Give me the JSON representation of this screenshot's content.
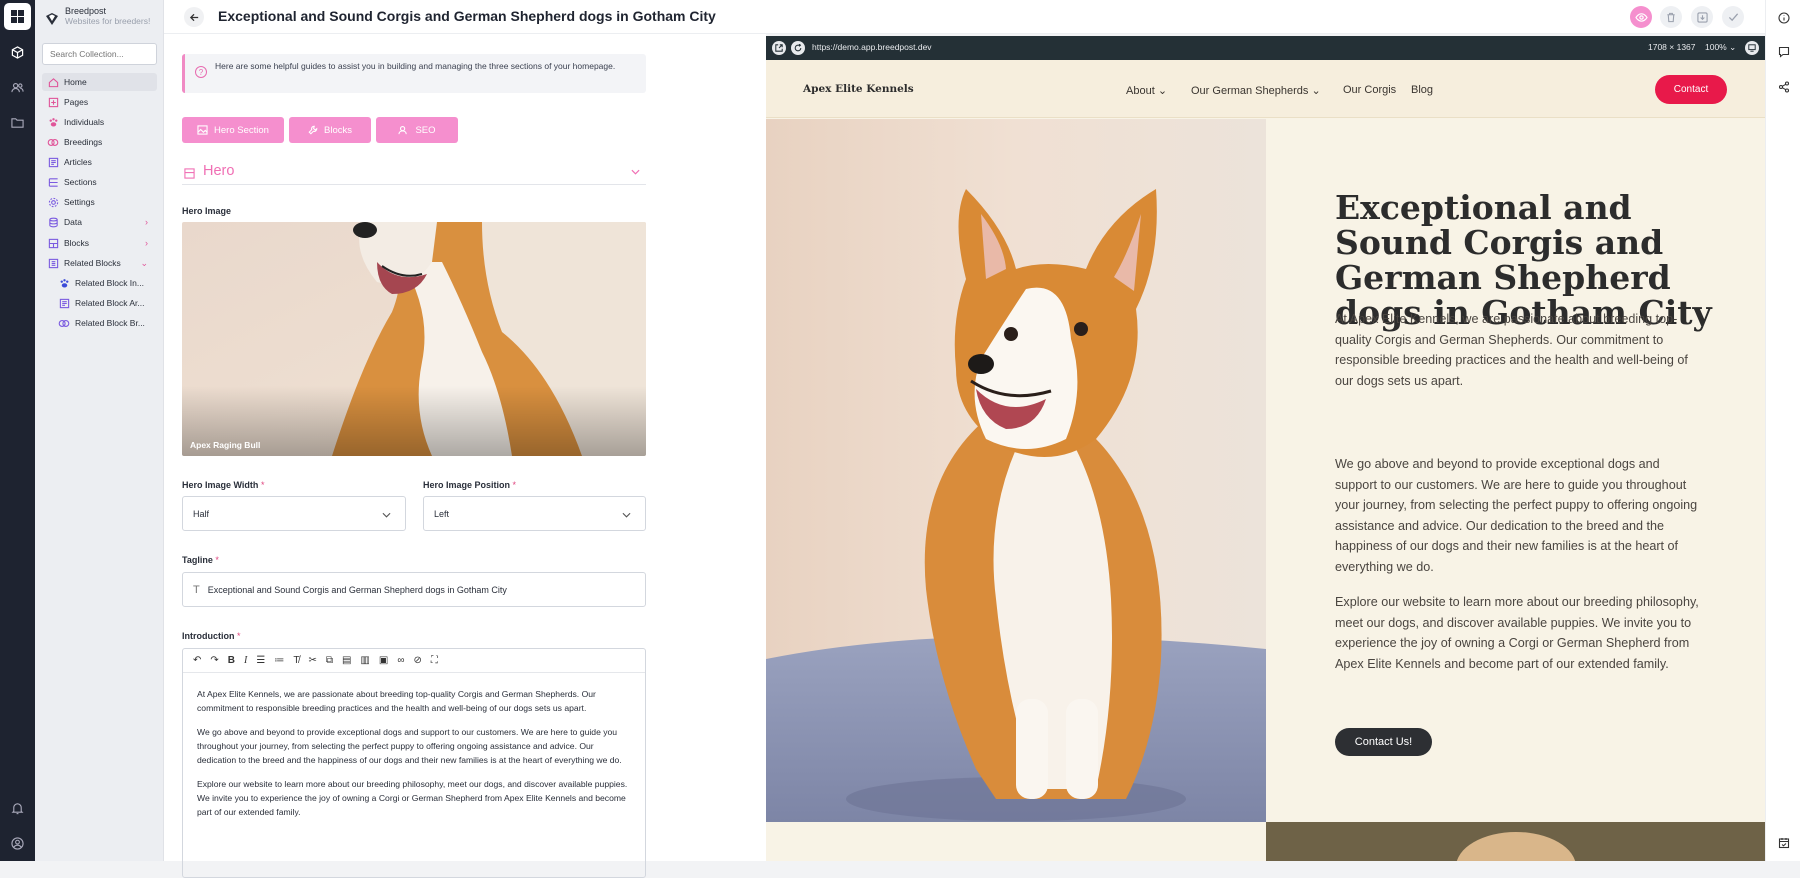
{
  "app": {
    "brand_name": "Breedpost",
    "brand_tagline": "Websites for breeders!",
    "search_placeholder": "Search Collection..."
  },
  "sidebar": {
    "items": [
      {
        "label": "Home",
        "icon": "home-icon",
        "active": true
      },
      {
        "label": "Pages",
        "icon": "plus-square-icon"
      },
      {
        "label": "Individuals",
        "icon": "paw-icon"
      },
      {
        "label": "Breedings",
        "icon": "rings-icon"
      },
      {
        "label": "Articles",
        "icon": "article-icon"
      },
      {
        "label": "Sections",
        "icon": "sections-icon"
      },
      {
        "label": "Settings",
        "icon": "gear-icon"
      },
      {
        "label": "Data",
        "icon": "database-icon",
        "chevron": "›"
      },
      {
        "label": "Blocks",
        "icon": "blocks-icon",
        "chevron": "›"
      },
      {
        "label": "Related Blocks",
        "icon": "related-blocks-icon",
        "chevron": "⌄"
      }
    ],
    "sub_items": [
      {
        "label": "Related Block In...",
        "icon": "paw-icon"
      },
      {
        "label": "Related Block Ar...",
        "icon": "article-icon"
      },
      {
        "label": "Related Block Br...",
        "icon": "rings-icon"
      }
    ]
  },
  "header": {
    "title": "Exceptional and Sound Corgis and German Shepherd dogs in Gotham City"
  },
  "editor": {
    "hint": "Here are some helpful guides to assist you in building and managing the three sections of your homepage.",
    "section_buttons": [
      "Hero Section",
      "Blocks",
      "SEO"
    ],
    "hero_heading": "Hero",
    "hero_image_label": "Hero Image",
    "hero_image_caption": "Apex Raging Bull",
    "width_label": "Hero Image Width",
    "width_value": "Half",
    "position_label": "Hero Image Position",
    "position_value": "Left",
    "tagline_label": "Tagline",
    "tagline_value": "Exceptional and Sound Corgis and German Shepherd dogs in Gotham City",
    "intro_label": "Introduction",
    "intro_paragraphs": [
      "At Apex Elite Kennels, we are passionate about breeding top-quality Corgis and German Shepherds. Our commitment to responsible breeding practices and the health and well-being of our dogs sets us apart.",
      "We go above and beyond to provide exceptional dogs and support to our customers. We are here to guide you throughout your journey, from selecting the perfect puppy to offering ongoing assistance and advice. Our dedication to the breed and the happiness of our dogs and their new families is at the heart of everything we do.",
      "Explore our website to learn more about our breeding philosophy, meet our dogs, and discover available puppies. We invite you to experience the joy of owning a Corgi or German Shepherd from Apex Elite Kennels and become part of our extended family."
    ]
  },
  "preview": {
    "url": "https://demo.app.breedpost.dev",
    "dimensions": "1708 × 1367",
    "zoom": "100%",
    "site_name": "Apex Elite Kennels",
    "nav": [
      "About",
      "Our German Shepherds",
      "Our Corgis",
      "Blog"
    ],
    "contact_label": "Contact",
    "hero_title": "Exceptional and Sound Corgis and German Shepherd dogs in Gotham City",
    "hero_paragraphs": [
      "At Apex Elite Kennels, we are passionate about breeding top-quality Corgis and German Shepherds. Our commitment to responsible breeding practices and the health and well-being of our dogs sets us apart.",
      "We go above and beyond to provide exceptional dogs and support to our customers. We are here to guide you throughout your journey, from selecting the perfect puppy to offering ongoing assistance and advice. Our dedication to the breed and the happiness of our dogs and their new families is at the heart of everything we do.",
      "Explore our website to learn more about our breeding philosophy, meet our dogs, and discover available puppies. We invite you to experience the joy of owning a Corgi or German Shepherd from Apex Elite Kennels and become part of our extended family."
    ],
    "cta_label": "Contact Us!"
  },
  "colors": {
    "accent_pink": "#f58fce",
    "contact_red": "#e8194a",
    "rail_dark": "#1e2330"
  }
}
